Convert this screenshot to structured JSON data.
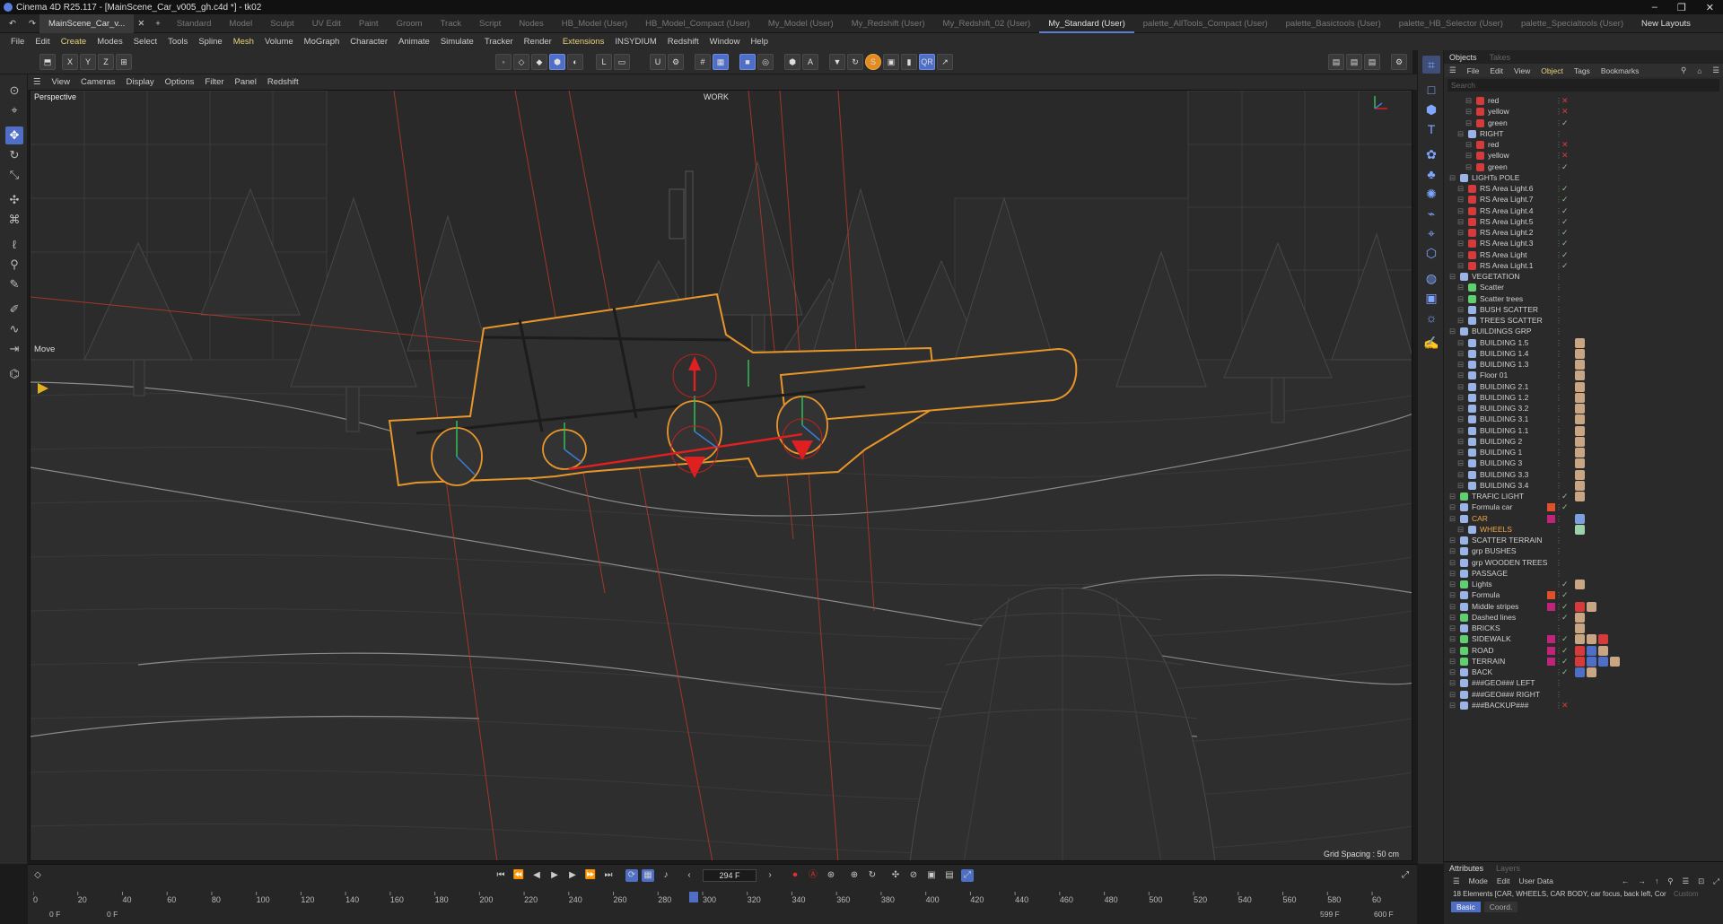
{
  "titlebar": {
    "title": "Cinema 4D R25.117 - [MainScene_Car_v005_gh.c4d *] - tk02"
  },
  "layouts": {
    "doc_tab": "MainScene_Car_v...",
    "tabs": [
      "Standard",
      "Model",
      "Sculpt",
      "UV Edit",
      "Paint",
      "Groom",
      "Track",
      "Script",
      "Nodes",
      "HB_Model (User)",
      "HB_Model_Compact (User)",
      "My_Model (User)",
      "My_Redshift (User)",
      "My_Redshift_02 (User)",
      "My_Standard (User)",
      "palette_AllTools_Compact (User)",
      "palette_Basictools (User)",
      "palette_HB_Selector (User)",
      "palette_Specialtools (User)"
    ],
    "active": "My_Standard (User)",
    "new_layouts": "New Layouts"
  },
  "menu": [
    "File",
    "Edit",
    "Create",
    "Modes",
    "Select",
    "Tools",
    "Spline",
    "Mesh",
    "Volume",
    "MoGraph",
    "Character",
    "Animate",
    "Simulate",
    "Tracker",
    "Render",
    "Extensions",
    "INSYDIUM",
    "Redshift",
    "Window",
    "Help"
  ],
  "viewport_menu": [
    "View",
    "Cameras",
    "Display",
    "Options",
    "Filter",
    "Panel",
    "Redshift"
  ],
  "viewport": {
    "label": "Perspective",
    "work": "WORK",
    "tool": "Move",
    "grid_spacing": "Grid Spacing : 50 cm"
  },
  "objects": {
    "tabs": [
      "Objects",
      "Takes"
    ],
    "menu": [
      "File",
      "Edit",
      "View",
      "Object",
      "Tags",
      "Bookmarks"
    ],
    "search": "Search",
    "rows": [
      {
        "name": "red",
        "indent": 2,
        "type": "light-red",
        "chk": "x"
      },
      {
        "name": "yellow",
        "indent": 2,
        "type": "light-red",
        "chk": "x"
      },
      {
        "name": "green",
        "indent": 2,
        "type": "light-red",
        "chk": "v"
      },
      {
        "name": "RIGHT",
        "indent": 1,
        "type": "null",
        "chk": ""
      },
      {
        "name": "red",
        "indent": 2,
        "type": "light-red",
        "chk": "x"
      },
      {
        "name": "yellow",
        "indent": 2,
        "type": "light-red",
        "chk": "x"
      },
      {
        "name": "green",
        "indent": 2,
        "type": "light-red",
        "chk": "v"
      },
      {
        "name": "LIGHTs POLE",
        "indent": 0,
        "type": "null",
        "chk": ""
      },
      {
        "name": "RS Area Light.6",
        "indent": 1,
        "type": "light-red",
        "chk": "v"
      },
      {
        "name": "RS Area Light.7",
        "indent": 1,
        "type": "light-red",
        "chk": "v"
      },
      {
        "name": "RS Area Light.4",
        "indent": 1,
        "type": "light-red",
        "chk": "v"
      },
      {
        "name": "RS Area Light.5",
        "indent": 1,
        "type": "light-red",
        "chk": "v"
      },
      {
        "name": "RS Area Light.2",
        "indent": 1,
        "type": "light-red",
        "chk": "v"
      },
      {
        "name": "RS Area Light.3",
        "indent": 1,
        "type": "light-red",
        "chk": "v"
      },
      {
        "name": "RS Area Light",
        "indent": 1,
        "type": "light-red",
        "chk": "v"
      },
      {
        "name": "RS Area Light.1",
        "indent": 1,
        "type": "light-red",
        "chk": "v"
      },
      {
        "name": "VEGETATION",
        "indent": 0,
        "type": "null",
        "chk": ""
      },
      {
        "name": "Scatter",
        "indent": 1,
        "type": "scatter",
        "chk": ""
      },
      {
        "name": "Scatter trees",
        "indent": 1,
        "type": "scatter",
        "chk": ""
      },
      {
        "name": "BUSH SCATTER",
        "indent": 1,
        "type": "null",
        "chk": ""
      },
      {
        "name": "TREES SCATTER",
        "indent": 1,
        "type": "null",
        "chk": ""
      },
      {
        "name": "BUILDINGS GRP",
        "indent": 0,
        "type": "null",
        "chk": ""
      },
      {
        "name": "BUILDING 1.5",
        "indent": 1,
        "type": "null",
        "chk": "",
        "tags": [
          "mat"
        ]
      },
      {
        "name": "BUILDING 1.4",
        "indent": 1,
        "type": "null",
        "chk": "",
        "tags": [
          "mat"
        ]
      },
      {
        "name": "BUILDING 1.3",
        "indent": 1,
        "type": "null",
        "chk": "",
        "tags": [
          "mat"
        ]
      },
      {
        "name": "Floor 01",
        "indent": 1,
        "type": "null",
        "chk": "",
        "tags": [
          "mat"
        ]
      },
      {
        "name": "BUILDING 2.1",
        "indent": 1,
        "type": "null",
        "chk": "",
        "tags": [
          "mat"
        ]
      },
      {
        "name": "BUILDING 1.2",
        "indent": 1,
        "type": "null",
        "chk": "",
        "tags": [
          "mat"
        ]
      },
      {
        "name": "BUILDING 3.2",
        "indent": 1,
        "type": "null",
        "chk": "",
        "tags": [
          "mat"
        ]
      },
      {
        "name": "BUILDING 3.1",
        "indent": 1,
        "type": "null",
        "chk": "",
        "tags": [
          "mat"
        ]
      },
      {
        "name": "BUILDING 1.1",
        "indent": 1,
        "type": "null",
        "chk": "",
        "tags": [
          "mat"
        ]
      },
      {
        "name": "BUILDING 2",
        "indent": 1,
        "type": "null",
        "chk": "",
        "tags": [
          "mat"
        ]
      },
      {
        "name": "BUILDING 1",
        "indent": 1,
        "type": "null",
        "chk": "",
        "tags": [
          "mat"
        ]
      },
      {
        "name": "BUILDING 3",
        "indent": 1,
        "type": "null",
        "chk": "",
        "tags": [
          "mat"
        ]
      },
      {
        "name": "BUILDING 3.3",
        "indent": 1,
        "type": "null",
        "chk": "",
        "tags": [
          "mat"
        ]
      },
      {
        "name": "BUILDING 3.4",
        "indent": 1,
        "type": "null",
        "chk": "",
        "tags": [
          "mat"
        ]
      },
      {
        "name": "TRAFIC LIGHT",
        "indent": 0,
        "type": "green",
        "chk": "v",
        "tags": [
          "mat"
        ]
      },
      {
        "name": "Formula car",
        "indent": 0,
        "type": "formula",
        "chk": "v",
        "swatch": "#e0502a"
      },
      {
        "name": "CAR",
        "indent": 0,
        "type": "null",
        "chk": "",
        "swatch": "#c0247a",
        "hi": true,
        "tags": [
          "tag"
        ]
      },
      {
        "name": "WHEELS",
        "indent": 1,
        "type": "null",
        "chk": "",
        "hi": true,
        "tags": [
          "sph"
        ]
      },
      {
        "name": "SCATTER TERRAIN",
        "indent": 0,
        "type": "null",
        "chk": ""
      },
      {
        "name": "grp BUSHES",
        "indent": 0,
        "type": "null",
        "chk": ""
      },
      {
        "name": "grp WOODEN TREES",
        "indent": 0,
        "type": "null",
        "chk": ""
      },
      {
        "name": "PASSAGE",
        "indent": 0,
        "type": "null",
        "chk": ""
      },
      {
        "name": "Lights",
        "indent": 0,
        "type": "green",
        "chk": "v",
        "tags": [
          "mat"
        ]
      },
      {
        "name": "Formula",
        "indent": 0,
        "type": "formula",
        "chk": "v",
        "swatch": "#e0502a"
      },
      {
        "name": "Middle stripes",
        "indent": 0,
        "type": "null",
        "chk": "v",
        "swatch": "#c0247a",
        "tags": [
          "red",
          "mat"
        ]
      },
      {
        "name": "Dashed lines",
        "indent": 0,
        "type": "green",
        "chk": "v",
        "tags": [
          "mat"
        ]
      },
      {
        "name": "BRICKS",
        "indent": 0,
        "type": "null",
        "chk": "",
        "tags": [
          "mat"
        ]
      },
      {
        "name": "SIDEWALK",
        "indent": 0,
        "type": "green",
        "chk": "v",
        "swatch": "#c0247a",
        "tags": [
          "mat",
          "mat",
          "red"
        ]
      },
      {
        "name": "ROAD",
        "indent": 0,
        "type": "green",
        "chk": "v",
        "swatch": "#c0247a",
        "tags": [
          "red",
          "blue",
          "mat"
        ]
      },
      {
        "name": "TERRAIN",
        "indent": 0,
        "type": "green",
        "chk": "v",
        "swatch": "#c0247a",
        "tags": [
          "red",
          "blue",
          "blue",
          "mat"
        ]
      },
      {
        "name": "BACK",
        "indent": 0,
        "type": "formula",
        "chk": "v",
        "tags": [
          "blue",
          "mat"
        ]
      },
      {
        "name": "###GEO### LEFT",
        "indent": 0,
        "type": "null",
        "chk": ""
      },
      {
        "name": "###GEO### RIGHT",
        "indent": 0,
        "type": "null",
        "chk": ""
      },
      {
        "name": "###BACKUP###",
        "indent": 0,
        "type": "null",
        "chk": "x"
      }
    ]
  },
  "attributes": {
    "tabs": [
      "Attributes",
      "Layers"
    ],
    "menu": [
      "Mode",
      "Edit",
      "User Data"
    ],
    "info": "18 Elements [CAR, WHEELS, CAR BODY, car focus, back left, Cor",
    "custom": "Custom",
    "buttons": [
      "Basic",
      "Coord."
    ]
  },
  "timeline": {
    "frame": "294 F",
    "start": "0 F",
    "start2": "0 F",
    "end": "599 F",
    "end2": "600 F",
    "ticks": [
      "0",
      "20",
      "40",
      "60",
      "80",
      "100",
      "120",
      "140",
      "160",
      "180",
      "200",
      "220",
      "240",
      "260",
      "280",
      "300",
      "320",
      "340",
      "360",
      "380",
      "400",
      "420",
      "440",
      "460",
      "480",
      "500",
      "520",
      "540",
      "560",
      "580",
      "60"
    ],
    "current": 294
  },
  "colors": {
    "accent": "#4f6fc6",
    "selection": "#f2a640",
    "axis_red": "#e02020",
    "brand_orange": "#e38b1f"
  }
}
